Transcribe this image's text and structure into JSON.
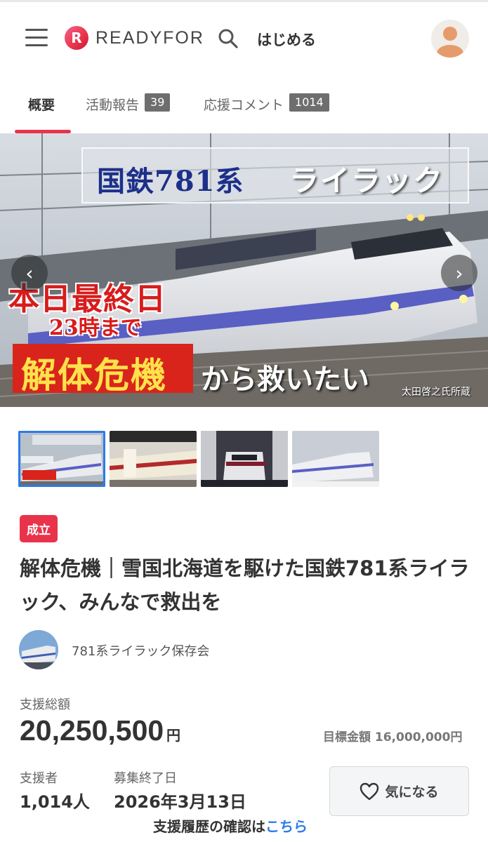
{
  "header": {
    "brand": "READYFOR",
    "brand_mark": "R",
    "start_label": "はじめる"
  },
  "tabs": [
    {
      "label": "概要",
      "badge": ""
    },
    {
      "label": "活動報告",
      "badge": "39"
    },
    {
      "label": "応援コメント",
      "badge": "1014"
    }
  ],
  "hero": {
    "title_a": "国鉄781系",
    "title_b": "ライラック",
    "final_day": "本日最終日",
    "until": "23時まで",
    "danger": "解体危機",
    "save": "から救いたい",
    "credit": "太田啓之氏所蔵"
  },
  "project": {
    "status": "成立",
    "title": "解体危機｜雪国北海道を駆けた国鉄781系ライラック、みんなで救出を",
    "owner": "781系ライラック保存会"
  },
  "stats": {
    "total_label": "支援総額",
    "total_amount": "20,250,500",
    "total_unit": "円",
    "goal": "目標金額 16,000,000円",
    "supporters_label": "支援者",
    "supporters": "1,014人",
    "end_label": "募集終了日",
    "end_date": "2026年3月13日"
  },
  "favorite_label": "気になる",
  "history": {
    "text": "支援履歴の確認は",
    "link": "こちら"
  },
  "colors": {
    "accent": "#e8334a",
    "link": "#2d7be8"
  }
}
